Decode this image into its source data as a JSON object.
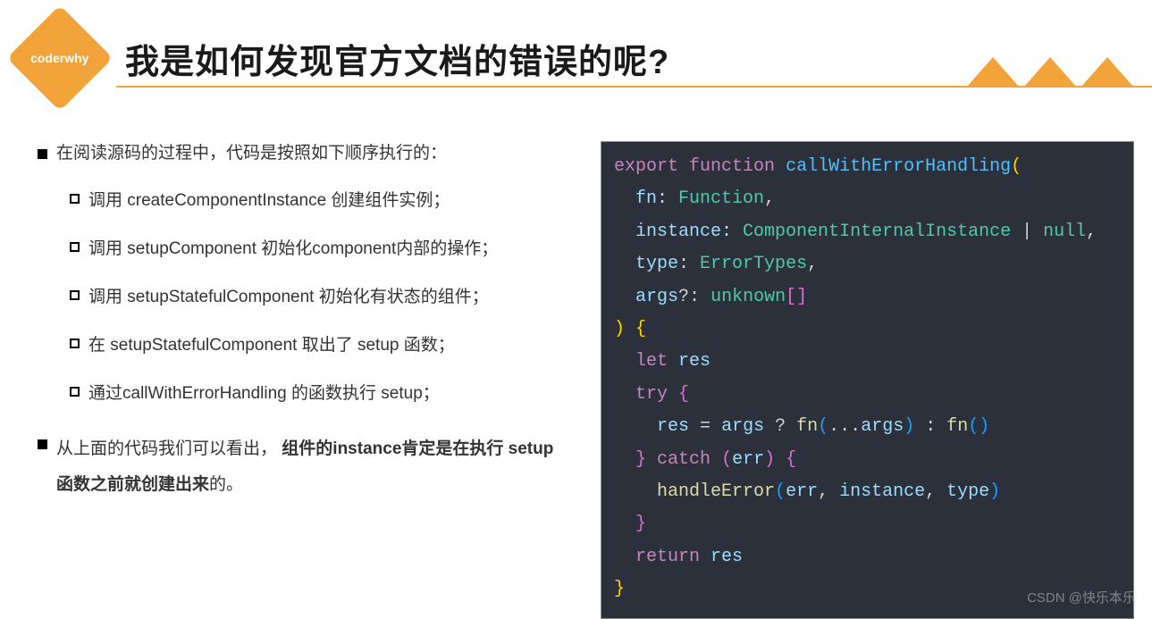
{
  "logo": "coderwhy",
  "title": "我是如何发现官方文档的错误的呢?",
  "intro": "在阅读源码的过程中，代码是按照如下顺序执行的：",
  "steps": [
    "调用 createComponentInstance 创建组件实例；",
    "调用 setupComponent 初始化component内部的操作；",
    "调用 setupStatefulComponent 初始化有状态的组件；",
    "在 setupStatefulComponent 取出了 setup 函数；",
    "通过callWithErrorHandling 的函数执行 setup；"
  ],
  "conclusion_prefix": "从上面的代码我们可以看出，",
  "conclusion_bold": "组件的instance肯定是在执行 setup 函数之前就创建出来",
  "conclusion_suffix": "的。",
  "code": {
    "l1_export": "export",
    "l1_function": "function",
    "l1_name": "callWithErrorHandling",
    "l1_open": "(",
    "l2_p": "fn",
    "l2_t": "Function",
    "l3_p": "instance",
    "l3_t": "ComponentInternalInstance",
    "l3_null": "null",
    "l4_p": "type",
    "l4_t": "ErrorTypes",
    "l5_p": "args",
    "l5_opt": "?",
    "l5_t": "unknown",
    "l5_br": "[]",
    "l6_close": ")",
    "l6_brace": "{",
    "l7_let": "let",
    "l7_res": "res",
    "l8_try": "try",
    "l8_brace": "{",
    "l9_res": "res",
    "l9_eq": "=",
    "l9_args": "args",
    "l9_q": "?",
    "l9_fn": "fn",
    "l9_spread": "...",
    "l9_args2": "args",
    "l9_colon": ":",
    "l9_fn2": "fn",
    "l10_close": "}",
    "l10_catch": "catch",
    "l10_open": "(",
    "l10_err": "err",
    "l10_cp": ")",
    "l10_brace": "{",
    "l11_handle": "handleError",
    "l11_err": "err",
    "l11_inst": "instance",
    "l11_type": "type",
    "l12_close": "}",
    "l13_return": "return",
    "l13_res": "res",
    "l14_close": "}"
  },
  "watermark": "CSDN @快乐本乐"
}
